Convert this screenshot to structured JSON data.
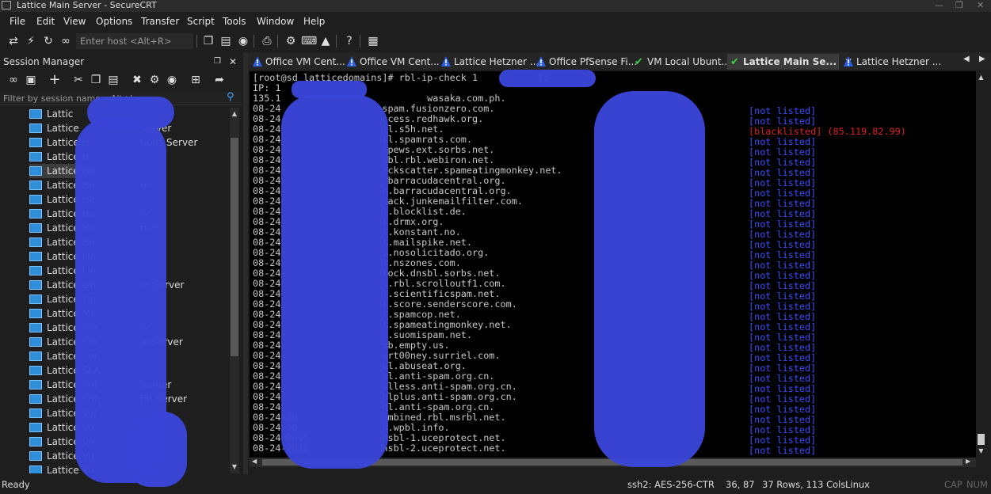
{
  "window": {
    "title": "Lattice Main Server - SecureCRT"
  },
  "menu": [
    "File",
    "Edit",
    "View",
    "Options",
    "Transfer",
    "Script",
    "Tools",
    "Window",
    "Help"
  ],
  "toolbar": {
    "host_placeholder": "Enter host <Alt+R>"
  },
  "session_manager": {
    "title": "Session Manager",
    "pin": "❒",
    "close": "✕",
    "filter_placeholder": "Filter by session name <Alt+I>",
    "items": [
      {
        "label": "Lattic"
      },
      {
        "label": "Lattice",
        "suffix": "Server"
      },
      {
        "label": "Lattice H",
        "suffix": "tions Server"
      },
      {
        "label": "Lattice H"
      },
      {
        "label": "Lattice He",
        "selected": true
      },
      {
        "label": "Lattice He",
        "suffix": "er"
      },
      {
        "label": "Lattice He"
      },
      {
        "label": "Lattice He",
        "suffix": "er"
      },
      {
        "label": "Lattice He",
        "suffix": "rver"
      },
      {
        "label": "Lattice He"
      },
      {
        "label": "Lattice Lin"
      },
      {
        "label": "Lattice Lin"
      },
      {
        "label": "Lattice Lin",
        "suffix": "er Server"
      },
      {
        "label": "Lattice Lin"
      },
      {
        "label": "Lattice Ma"
      },
      {
        "label": "Lattice Ser",
        "suffix": "er"
      },
      {
        "label": "Lattice Ser",
        "suffix": "al Server"
      },
      {
        "label": "Lattice Ser"
      },
      {
        "label": "Lattice SLA"
      },
      {
        "label": "Lattice Sof",
        "suffix": "Server"
      },
      {
        "label": "Lattice Sof",
        "suffix": "ER Server"
      },
      {
        "label": "Lattice Vul"
      },
      {
        "label": "Lattice Vu",
        "suffix": "ver"
      },
      {
        "label": "Lattice Vu"
      },
      {
        "label": "Lattice Vu"
      },
      {
        "label": "Lattice Vu"
      }
    ]
  },
  "tabs": [
    {
      "label": "Office VM Cent...",
      "icon": "warning"
    },
    {
      "label": "Office VM Cent...",
      "icon": "warning"
    },
    {
      "label": "Lattice Hetzner ...",
      "icon": "warning"
    },
    {
      "label": "Office PfSense Fi...",
      "icon": "warning"
    },
    {
      "label": "VM Local Ubunt...",
      "icon": "check"
    },
    {
      "label": "Lattice Main Se...",
      "icon": "check",
      "active": true,
      "close": "✕"
    },
    {
      "label": "Lattice Hetzner ...",
      "icon": "warning"
    }
  ],
  "terminal": {
    "prompt": "[root@sd latticedomains]# rbl-ip-check 1",
    "prompt_tail": "11",
    "ip_line": "IP: 1",
    "host_line": "135.1                          wasaka.com.ph.",
    "lines": [
      {
        "date": "08-24",
        "host": "                  spam.fusionzero.com.",
        "status": "[not listed]"
      },
      {
        "date": "08-24",
        "host": "                  ccess.redhawk.org.",
        "status": "[not listed]"
      },
      {
        "date": "08-24",
        "host": "                  ll.s5h.net.",
        "status": "[blacklisted] (85.119.82.99)",
        "bad": true
      },
      {
        "date": "08-24",
        "host": "                  ll.spamrats.com.",
        "status": "[not listed]"
      },
      {
        "date": "08-24",
        "host": "                  spews.ext.sorbs.net.",
        "status": "[not listed]"
      },
      {
        "date": "08-24",
        "host": "                  abl.rbl.webiron.net.",
        "status": "[not listed]"
      },
      {
        "date": "08-24",
        "host": "                  ackscatter.spameatingmonkey.net.",
        "status": "[not listed]"
      },
      {
        "date": "08-24",
        "host": "                  .barracudacentral.org.",
        "status": "[not listed]"
      },
      {
        "date": "08-24",
        "host": "                  b.barracudacentral.org.",
        "status": "[not listed]"
      },
      {
        "date": "08-24",
        "host": "                  lack.junkemailfilter.com.",
        "status": "[not listed]"
      },
      {
        "date": "08-24",
        "host": "                  l.blocklist.de.",
        "status": "[not listed]"
      },
      {
        "date": "08-24",
        "host": "                  l.drmx.org.",
        "status": "[not listed]"
      },
      {
        "date": "08-24",
        "host": "                  l.konstant.no.",
        "status": "[not listed]"
      },
      {
        "date": "08-24",
        "host": "                  l.mailspike.net.",
        "status": "[not listed]"
      },
      {
        "date": "08-24",
        "host": "                  l.nosolicitado.org.",
        "status": "[not listed]"
      },
      {
        "date": "08-24",
        "host": "                  l.nszones.com.",
        "status": "[not listed]"
      },
      {
        "date": "08-24",
        "host": "                  lock.dnsbl.sorbs.net.",
        "status": "[not listed]"
      },
      {
        "date": "08-24",
        "host": "                  l.rbl.scrolloutf1.com.",
        "status": "[not listed]"
      },
      {
        "date": "08-24",
        "host": "                  l.scientificspam.net.",
        "status": "[not listed]"
      },
      {
        "date": "08-24",
        "host": "                  l.score.senderscore.com.",
        "status": "[not listed]"
      },
      {
        "date": "08-24",
        "host": "                  l.spamcop.net.",
        "status": "[not listed]"
      },
      {
        "date": "08-24",
        "host": "                  l.spameatingmonkey.net.",
        "status": "[not listed]"
      },
      {
        "date": "08-24",
        "host": "                  l.suomispam.net.",
        "status": "[not listed]"
      },
      {
        "date": "08-24",
        "host": "                  sb.empty.us.",
        "status": "[not listed]"
      },
      {
        "date": "08-24",
        "host": "                  art00ney.surriel.com.",
        "status": "[not listed]"
      },
      {
        "date": "08-24",
        "host": "                  bl.abuseat.org.",
        "status": "[not listed]"
      },
      {
        "date": "08-24",
        "host": "                  bl.anti-spam.org.cn.",
        "status": "[not listed]"
      },
      {
        "date": "08-24",
        "host": "                  olless.anti-spam.org.cn.",
        "status": "[not listed]"
      },
      {
        "date": "08-24",
        "host": "                  blplus.anti-spam.org.cn.",
        "status": "[not listed]"
      },
      {
        "date": "08-24",
        "host": "                  dl.anti-spam.org.cn.",
        "status": "[not listed]"
      },
      {
        "date": "08-24-20",
        "host": "               ombined.rbl.msrbl.net.",
        "status": "[not listed]"
      },
      {
        "date": "08-24-20",
        "host": "               o.wpbl.info.",
        "status": "[not listed]"
      },
      {
        "date": "08-24-2011",
        "host": "             nsbl-1.uceprotect.net.",
        "status": "[not listed]"
      },
      {
        "date": "08-24-2011.",
        "host": "            nsbl-2.uceprotect.net.",
        "status": "[not listed]"
      }
    ]
  },
  "statusbar": {
    "ready": "Ready",
    "cipher": "ssh2: AES-256-CTR",
    "pos": "36,  87",
    "dims": "37 Rows, 113 Cols",
    "os": "Linux",
    "cap": "CAP",
    "num": "NUM"
  },
  "colors": {
    "not_listed": "#3a4fff",
    "blacklisted": "#e02020",
    "redaction": "#3a45d8"
  }
}
